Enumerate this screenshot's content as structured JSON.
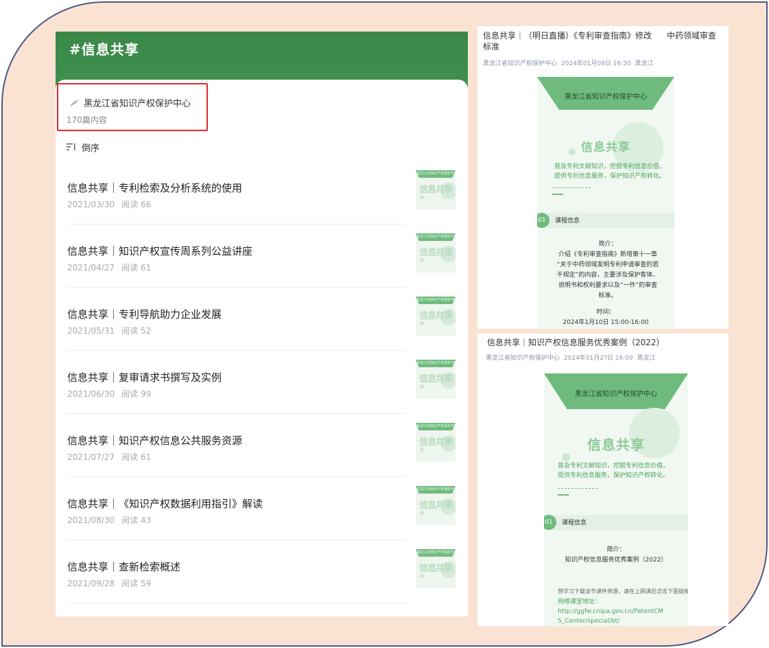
{
  "account": {
    "hashtag_title": "#信息共享",
    "author_name": "黑龙江省知识产权保护中心",
    "content_count": "170篇内容",
    "sort_label": "倒序"
  },
  "articles": [
    {
      "title": "信息共享｜专利检索及分析系统的使用",
      "date": "2021/03/30",
      "reads": "阅读 66"
    },
    {
      "title": "信息共享｜知识产权宣传周系列公益讲座",
      "date": "2021/04/27",
      "reads": "阅读 61"
    },
    {
      "title": "信息共享｜专利导航助力企业发展",
      "date": "2021/05/31",
      "reads": "阅读 52"
    },
    {
      "title": "信息共享｜复审请求书撰写及实例",
      "date": "2021/06/30",
      "reads": "阅读 99"
    },
    {
      "title": "信息共享｜知识产权信息公共服务资源",
      "date": "2021/07/27",
      "reads": "阅读 61"
    },
    {
      "title": "信息共享｜《知识产权数据利用指引》解读",
      "date": "2021/08/30",
      "reads": "阅读 43"
    },
    {
      "title": "信息共享｜查新检索概述",
      "date": "2021/09/28",
      "reads": "阅读 59"
    }
  ],
  "thumb": {
    "top_text": "黑龙江省知识产权保护中心",
    "big_text": "信息共享"
  },
  "card1": {
    "title_line1": "信息共享｜（明日直播）《专利审查指南》修改",
    "title_tail": "中药领域审查",
    "title_line2": "标准",
    "meta_author": "黑龙江省知识产权保护中心",
    "meta_date": "2024年01月09日 16:30",
    "meta_place": "黑龙江",
    "banner": "黑龙江省知识产权保护中心",
    "headline": "信息共享",
    "desc_line1": "普及专利文献知识，挖掘专利信息价值，",
    "desc_line2": "提供专利信息服务，保护知识产权转化。",
    "section_num": "01",
    "section_label": "课程信息",
    "intro_label": "简介：",
    "intro_line1": "介绍《专利审查指南》新增第十一章",
    "intro_line2": "“关于中药领域发明专利申请审查的若",
    "intro_line3": "干规定”的内容，主要涉及保护客体、",
    "intro_line4": "说明书和权利要求以及“一件”的审查",
    "intro_line5": "标准。",
    "time_label": "时间：",
    "time_value": "2024年1月10日 15:00-16:00"
  },
  "card2": {
    "title": "信息共享｜知识产权信息服务优秀案例（2022）",
    "meta_author": "黑龙江省知识产权保护中心",
    "meta_date": "2024年01月2?日 16:00",
    "meta_place": "黑龙江",
    "banner": "黑龙江省知识产权保护中心",
    "headline": "信息共享",
    "desc_line1": "普及专利文献知识，挖掘专利信息价值，",
    "desc_line2": "提供专利信息服务，保护知识产权转化。",
    "section_num": "01",
    "section_label": "课程信息",
    "intro_label": "简介：",
    "intro_line1": "知识产权信息服务优秀案例（2022）",
    "small_note": "想学习下载该节课件资源，请在上网课后点击下面链接",
    "link_label": "网络课堂地址：",
    "link_line1": "http://ggfw.cnipa.gov.cn/PatentCM",
    "link_line2": "S_Center/special/bt/"
  }
}
